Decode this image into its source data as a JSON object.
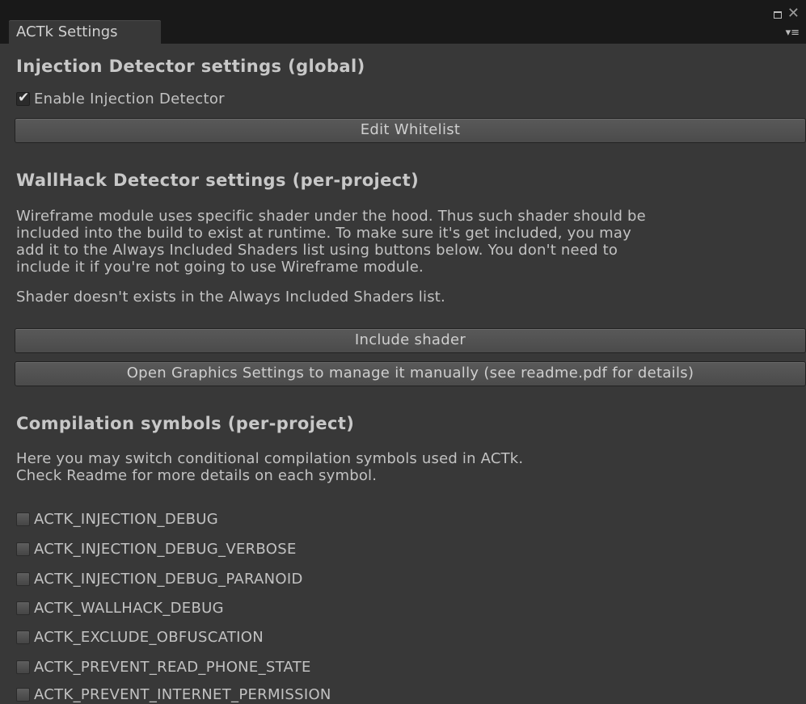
{
  "window": {
    "tab_title": "ACTk Settings",
    "close_glyph": "✕",
    "menu_glyph": "▾≡"
  },
  "injection": {
    "heading": "Injection Detector settings (global)",
    "enable_label": "Enable Injection Detector",
    "enable_checked": true,
    "edit_whitelist_label": "Edit Whitelist"
  },
  "wallhack": {
    "heading": "WallHack Detector settings (per-project)",
    "description_lines": [
      "Wireframe module uses specific shader under the hood. Thus such shader should be",
      "included into the build to exist at runtime. To make sure it's get included, you may",
      "add it to the Always Included Shaders list using buttons below. You don't need to",
      "include it if you're not going to use Wireframe module."
    ],
    "status": "Shader doesn't exists in the Always Included Shaders list.",
    "include_shader_label": "Include shader",
    "open_graphics_label": "Open Graphics Settings to manage it manually (see readme.pdf for details)"
  },
  "compilation": {
    "heading": "Compilation symbols (per-project)",
    "description_lines": [
      "Here you may switch conditional compilation symbols used in ACTk.",
      "Check Readme for more details on each symbol."
    ],
    "symbols": [
      {
        "label": "ACTK_INJECTION_DEBUG",
        "checked": false
      },
      {
        "label": "ACTK_INJECTION_DEBUG_VERBOSE",
        "checked": false
      },
      {
        "label": "ACTK_INJECTION_DEBUG_PARANOID",
        "checked": false
      },
      {
        "label": "ACTK_WALLHACK_DEBUG",
        "checked": false
      },
      {
        "label": "ACTK_EXCLUDE_OBFUSCATION",
        "checked": false
      },
      {
        "label": "ACTK_PREVENT_READ_PHONE_STATE",
        "checked": false
      },
      {
        "label": "ACTK_PREVENT_INTERNET_PERMISSION",
        "checked": false
      }
    ]
  }
}
